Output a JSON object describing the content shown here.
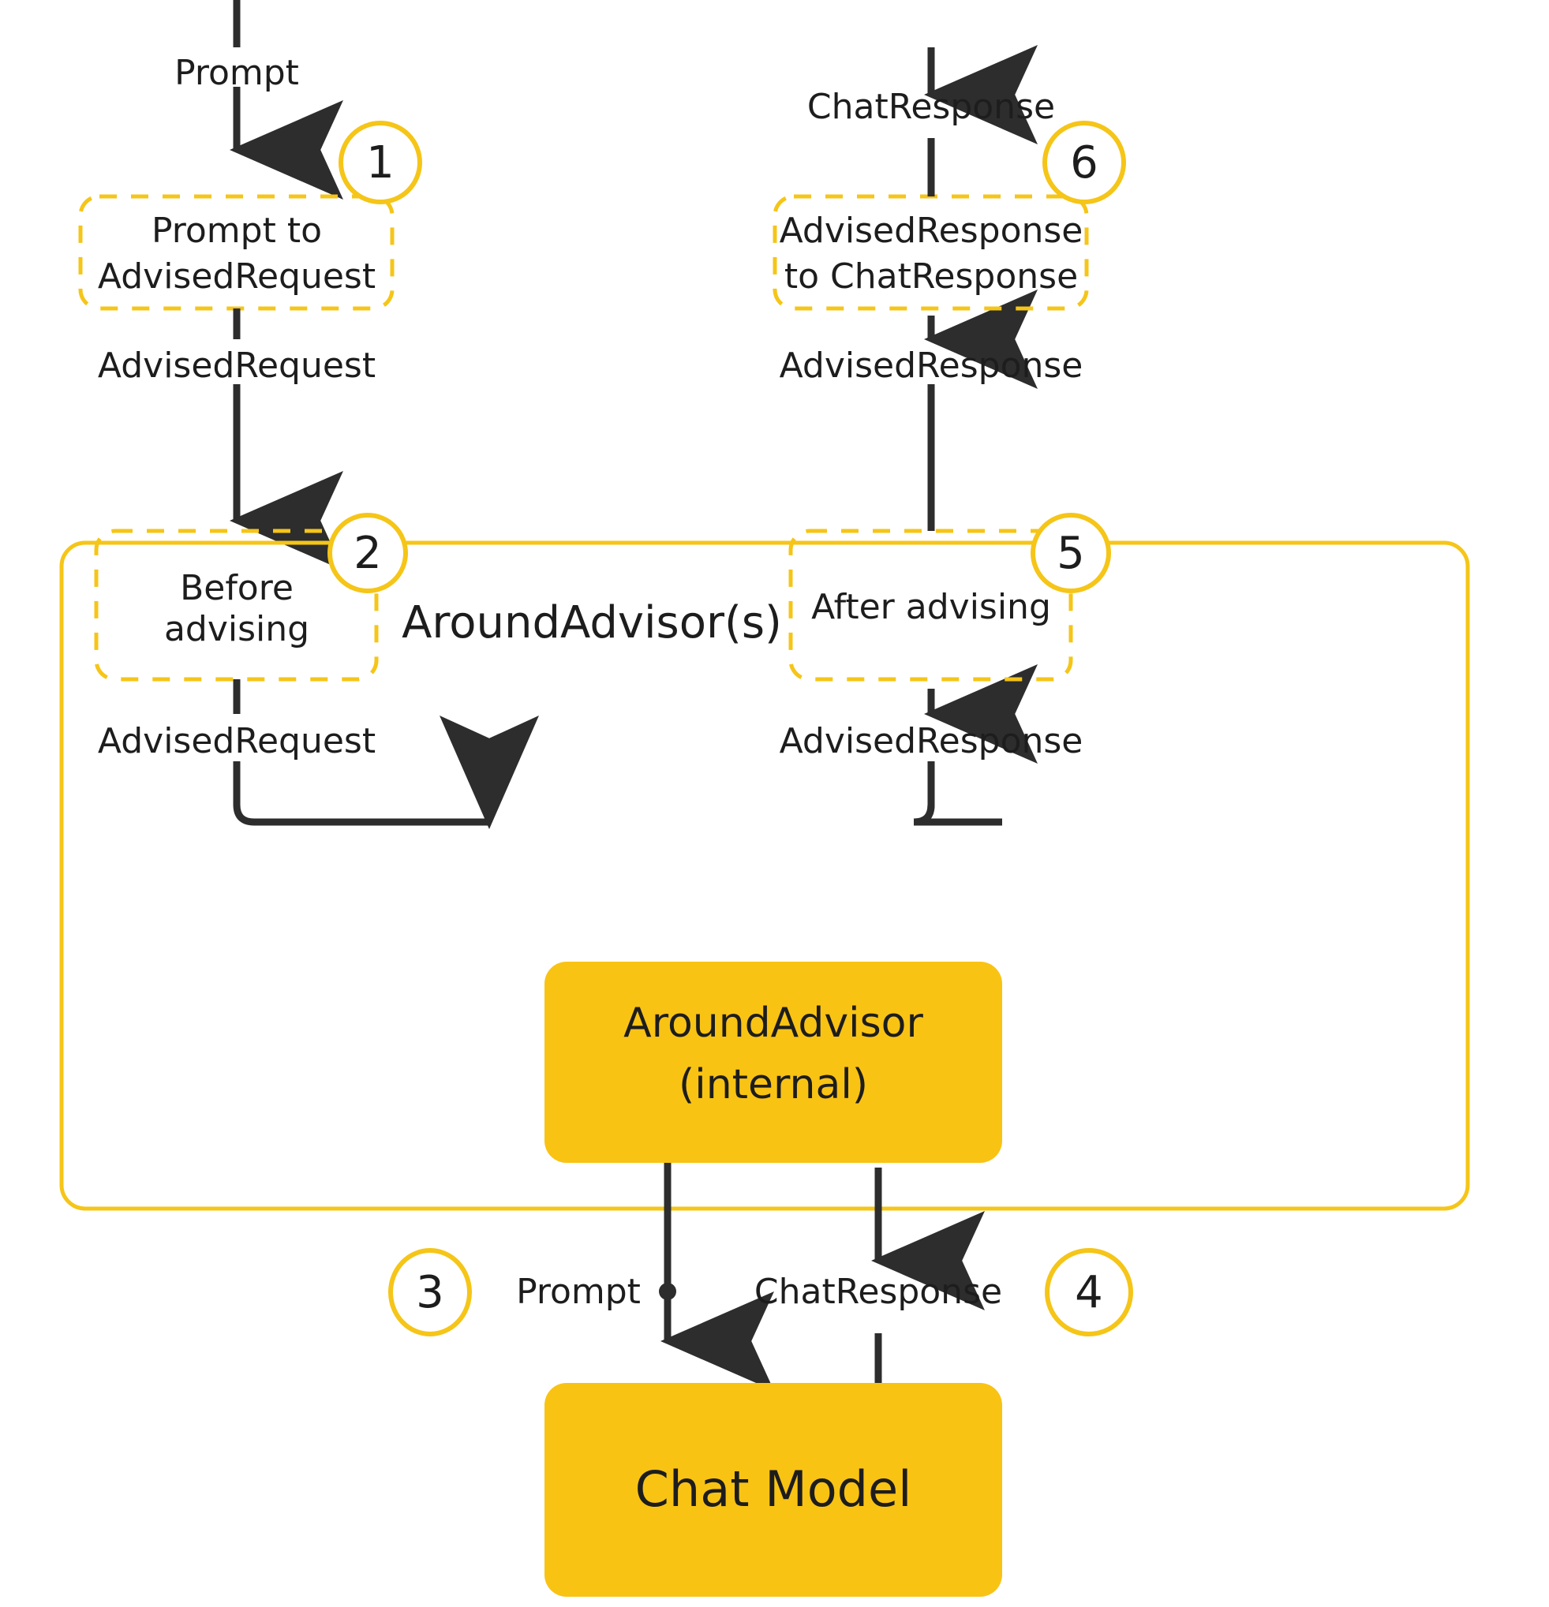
{
  "diagram": {
    "title": "Spring AI Advisor flow",
    "colors": {
      "accent": "#F5C518",
      "accent_fill": "#F9C314",
      "ink": "#2D2D2D",
      "text": "#1D1D1D",
      "background": "#FFFFFF"
    },
    "group": {
      "label": "AroundAdvisor(s)"
    },
    "steps": [
      {
        "number": "1",
        "label_line1": "Prompt to",
        "label_line2": "AdvisedRequest"
      },
      {
        "number": "2",
        "label_line1": "Before",
        "label_line2": "advising"
      },
      {
        "number": "3",
        "label_line1": "Prompt",
        "label_line2": ""
      },
      {
        "number": "4",
        "label_line1": "ChatResponse",
        "label_line2": ""
      },
      {
        "number": "5",
        "label_line1": "After advising",
        "label_line2": ""
      },
      {
        "number": "6",
        "label_line1": "AdvisedResponse",
        "label_line2": "to ChatResponse"
      }
    ],
    "nodes": {
      "around_advisor_internal_line1": "AroundAdvisor",
      "around_advisor_internal_line2": "(internal)",
      "chat_model": "Chat Model"
    },
    "edges": {
      "prompt_in": "Prompt",
      "advised_request_1": "AdvisedRequest",
      "advised_request_2": "AdvisedRequest",
      "prompt_to_model": "Prompt",
      "chat_response_from_model": "ChatResponse",
      "advised_response_1": "AdvisedResponse",
      "advised_response_2": "AdvisedResponse",
      "chat_response_out": "ChatResponse"
    }
  }
}
